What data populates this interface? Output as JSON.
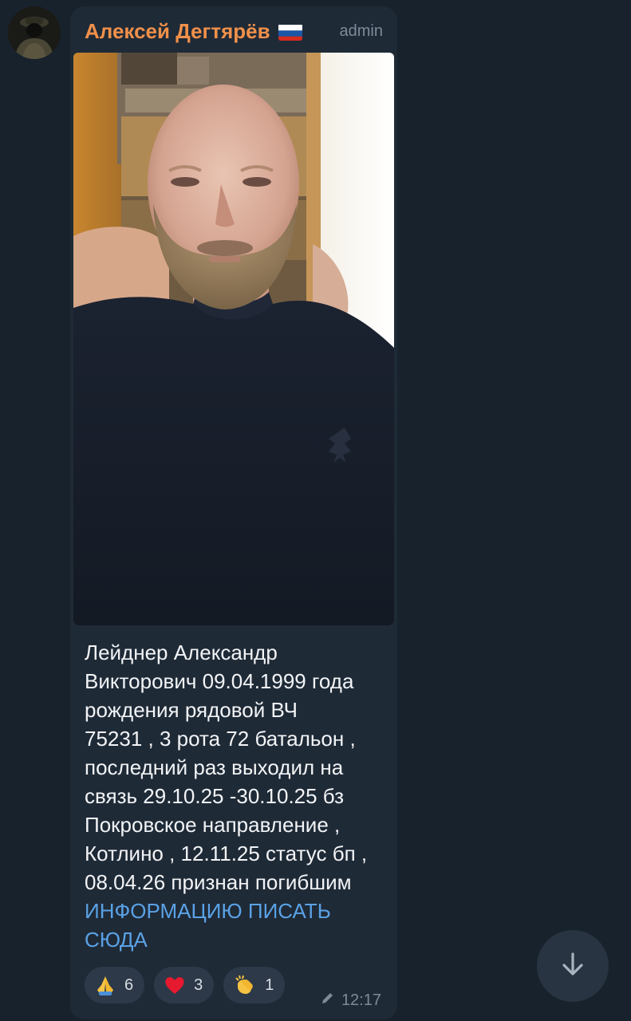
{
  "message": {
    "sender_name": "Алексей Дегтярёв",
    "sender_flag": "russia-flag-icon",
    "sender_role": "admin",
    "text": "Лейднер Александр\nВикторович 09.04.1999 года\nрождения рядовой ВЧ\n75231 , 3 рота 72 батальон ,\nпоследний раз выходил на\nсвязь 29.10.25 -30.10.25 бз\nПокровское направление ,\nКотлино , 12.11.25 статус бп ,\n08.04.26 признан погибшим",
    "link_text": "ИНФОРМАЦИЮ ПИСАТЬ\nСЮДА",
    "reactions": [
      {
        "icon": "folded-hands-icon",
        "count": "6"
      },
      {
        "icon": "red-heart-icon",
        "count": "3"
      },
      {
        "icon": "clapping-hands-icon",
        "count": "1"
      }
    ],
    "edited_icon": "pencil-icon",
    "time": "12:17"
  },
  "colors": {
    "background": "#18222d",
    "bubble": "#1f2a37",
    "sender_name": "#f0904a",
    "link": "#5aa2e6",
    "meta": "#7d8b99"
  },
  "scroll_button_icon": "arrow-down-icon"
}
